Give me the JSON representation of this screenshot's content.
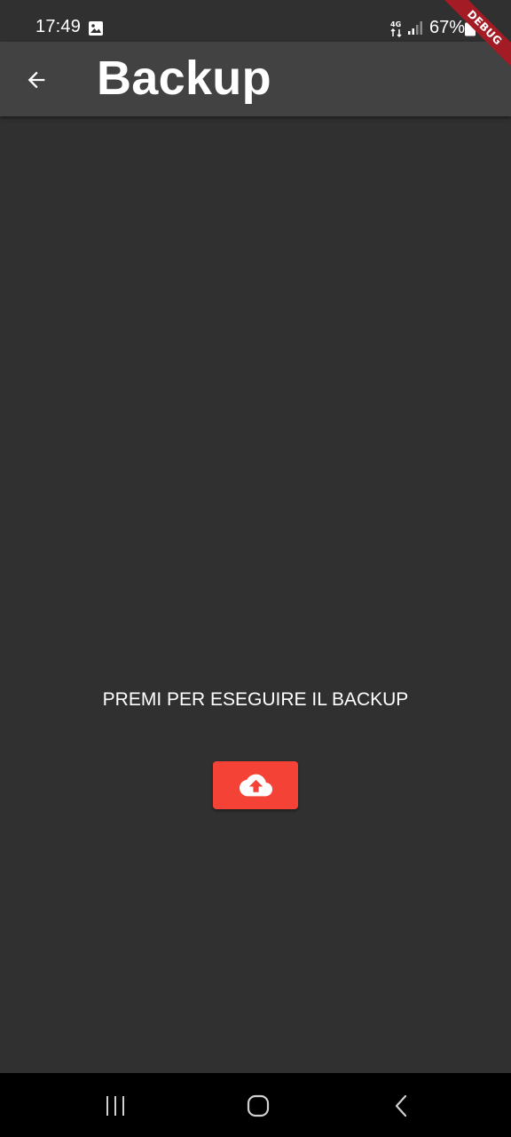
{
  "status_bar": {
    "time": "17:49",
    "network": "4G",
    "battery_percent": "67%",
    "icons": [
      "gallery-icon",
      "network-4g-icon",
      "signal-icon",
      "battery-icon"
    ]
  },
  "debug_banner": {
    "label": "DEBUG",
    "color": "#a31c25"
  },
  "app_bar": {
    "title": "Backup",
    "back_icon": "arrow-back-icon",
    "background": "#424242"
  },
  "main": {
    "instruction": "PREMI PER ESEGUIRE IL BACKUP",
    "backup_button": {
      "icon": "cloud-upload-icon",
      "color": "#f44336"
    },
    "background": "#303030"
  },
  "nav_bar": {
    "items": [
      "recents-icon",
      "home-icon",
      "back-icon"
    ]
  }
}
